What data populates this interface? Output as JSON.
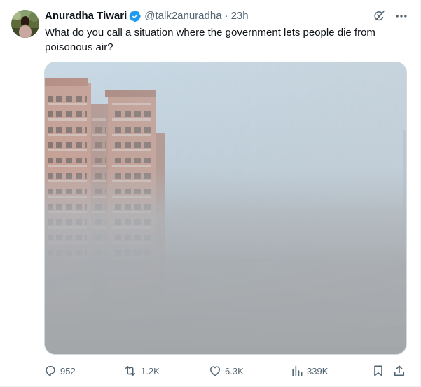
{
  "author": {
    "display_name": "Anuradha Tiwari",
    "handle": "@talk2anuradha",
    "separator": "·",
    "time": "23h",
    "verified_color": "#1d9bf0"
  },
  "tweet": {
    "text": "What do you call a situation where the government lets people die from poisonous air?"
  },
  "header_actions": {
    "icons": [
      "grok-icon",
      "more-icon"
    ]
  },
  "stats": {
    "replies": "952",
    "retweets": "1.2K",
    "likes": "6.3K",
    "views": "339K"
  },
  "colors": {
    "text_primary": "#0f1419",
    "text_secondary": "#536471",
    "accent": "#1d9bf0",
    "border": "#cfd9de"
  }
}
